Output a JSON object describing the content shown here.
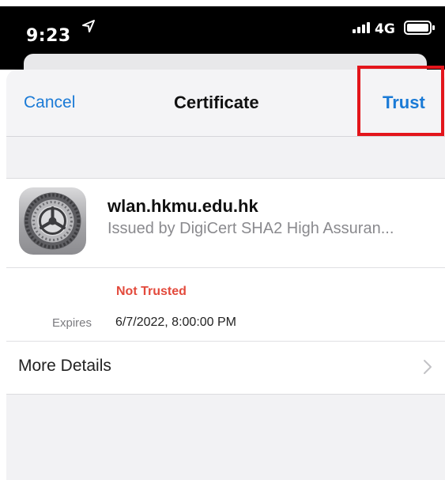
{
  "status_bar": {
    "time": "9:23",
    "network": "4G",
    "icons": [
      "location-arrow-icon",
      "signal-bars-icon",
      "battery-icon"
    ]
  },
  "navbar": {
    "cancel_label": "Cancel",
    "title": "Certificate",
    "trust_label": "Trust"
  },
  "certificate": {
    "icon": "settings-gear-icon",
    "name": "wlan.hkmu.edu.hk",
    "issuer": "Issued by DigiCert SHA2 High Assuran...",
    "status": "Not Trusted",
    "expires_label": "Expires",
    "expires_value": "6/7/2022, 8:00:00 PM"
  },
  "more_details": {
    "label": "More Details",
    "icon": "chevron-right-icon"
  },
  "colors": {
    "accent": "#1a7ad6",
    "danger": "#e34a3c",
    "highlight": "#e3151b"
  }
}
